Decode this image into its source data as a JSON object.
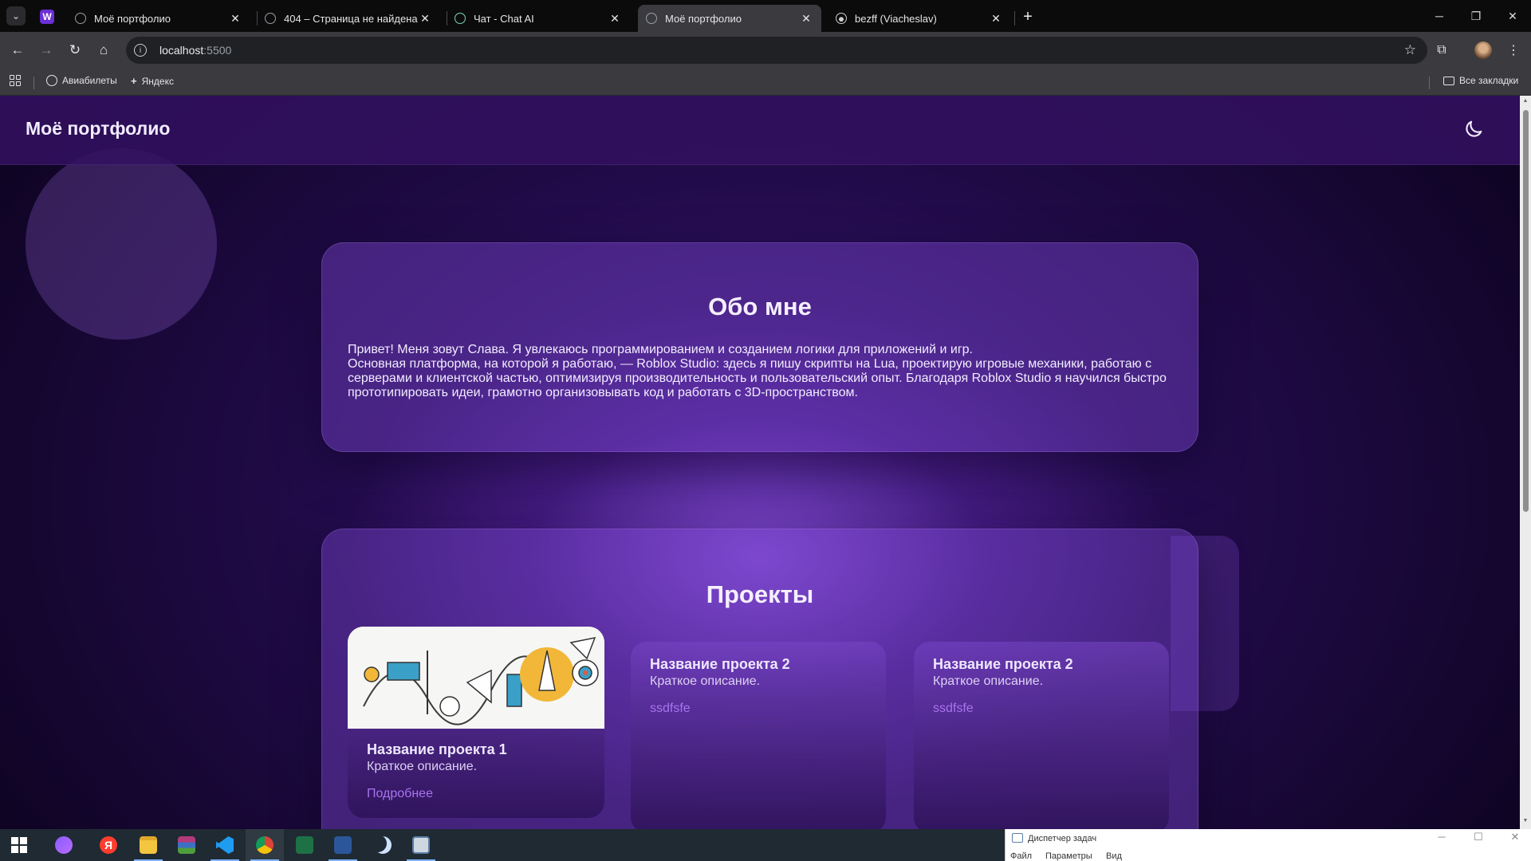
{
  "browser": {
    "tabs": [
      {
        "title": "Моё портфолио",
        "active": false
      },
      {
        "title": "404 – Страница не найдена",
        "active": false
      },
      {
        "title": "Чат - Chat AI",
        "active": false
      },
      {
        "title": "Моё портфолио",
        "active": true
      },
      {
        "title": "bezff (Viacheslav)",
        "active": false
      }
    ],
    "address": {
      "host": "localhost",
      "port": ":5500"
    },
    "bookmarks": [
      {
        "label": "Авиабилеты"
      },
      {
        "label": "Яндекс"
      }
    ],
    "all_bookmarks": "Все закладки",
    "pinned_icon": "W"
  },
  "page": {
    "site_title": "Моё портфолио",
    "theme_icon": "moon-icon",
    "about": {
      "heading": "Обо мне",
      "line1": "Привет! Меня зовут Слава. Я увлекаюсь программированием и созданием логики для приложений и игр.",
      "line2": "Основная платформа, на которой я работаю, — Roblox Studio: здесь я пишу скрипты на Lua, проектирую игровые механики, работаю с серверами и клиентской частью, оптимизируя производительность и пользовательский опыт. Благодаря Roblox Studio я научился быстро прототипировать идеи, грамотно организовывать код и работать с 3D-пространством."
    },
    "projects": {
      "heading": "Проекты",
      "items": [
        {
          "title": "Название проекта 1",
          "desc": "Краткое описание.",
          "link": "Подробнее"
        },
        {
          "title": "Название проекта 2",
          "desc": "Краткое описание.",
          "link": "ssdfsfe"
        },
        {
          "title": "Название проекта 2",
          "desc": "Краткое описание.",
          "link": "ssdfsfe"
        }
      ]
    }
  },
  "taskbar": {
    "task_manager": {
      "title": "Диспетчер задач",
      "menu": [
        "Файл",
        "Параметры",
        "Вид"
      ]
    }
  },
  "colors": {
    "accent": "#a874ee",
    "header_bg": "#32105f",
    "card_bg": "#7d48d2"
  }
}
